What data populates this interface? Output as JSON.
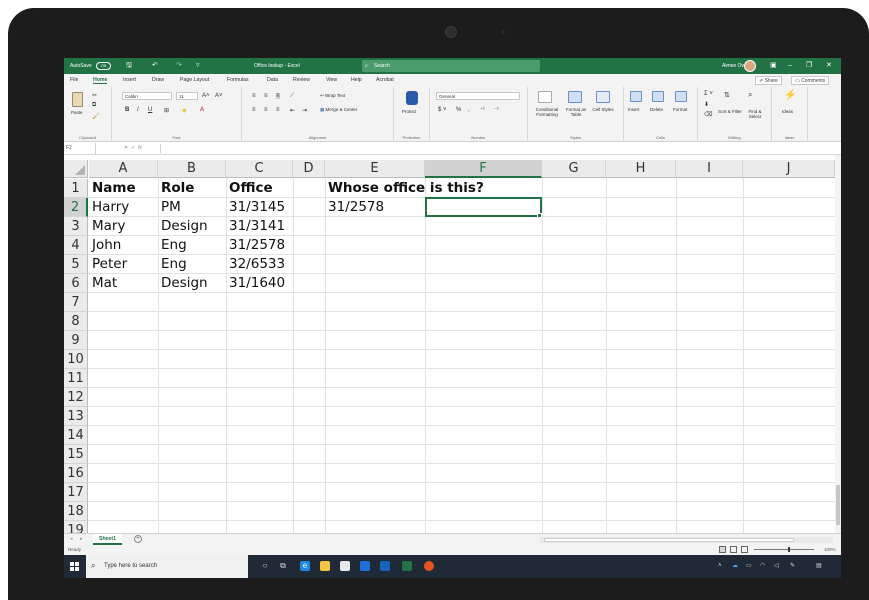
{
  "titlebar": {
    "autosave": "AutoSave",
    "autosave_state": "Off",
    "title": "Office lookup - Excel",
    "search_placeholder": "Search",
    "user": "Aimee Owens",
    "minimize": "–",
    "restore": "❐",
    "close": "✕"
  },
  "ribbon_tabs": [
    "File",
    "Home",
    "Insert",
    "Draw",
    "Page Layout",
    "Formulas",
    "Data",
    "Review",
    "View",
    "Help",
    "Acrobat"
  ],
  "share": "Share",
  "comments": "Comments",
  "ribbon": {
    "clipboard": {
      "label": "Clipboard",
      "paste": "Paste"
    },
    "font": {
      "label": "Font",
      "name": "Calibri",
      "size": "11"
    },
    "alignment": {
      "label": "Alignment",
      "wrap": "Wrap Text",
      "merge": "Merge & Center"
    },
    "protection": {
      "label": "Protection",
      "protect": "Protect"
    },
    "number": {
      "label": "Number",
      "format": "General"
    },
    "styles": {
      "label": "Styles",
      "conditional": "Conditional Formatting",
      "format_table": "Format as Table",
      "cell_styles": "Cell Styles"
    },
    "cells": {
      "label": "Cells",
      "insert": "Insert",
      "delete": "Delete",
      "format": "Format"
    },
    "editing": {
      "label": "Editing",
      "sort": "Sort & Filter",
      "find": "Find & Select"
    },
    "ideas": {
      "label": "Ideas",
      "ideas": "Ideas"
    }
  },
  "formula_bar": {
    "name_box": "F2",
    "fx": "fx",
    "content": ""
  },
  "columns": [
    "A",
    "B",
    "C",
    "D",
    "E",
    "F",
    "G",
    "H",
    "I",
    "J"
  ],
  "rows": [
    "1",
    "2",
    "3",
    "4",
    "5",
    "6",
    "7",
    "8",
    "9",
    "10",
    "11",
    "12",
    "13",
    "14",
    "15",
    "16",
    "17",
    "18",
    "19"
  ],
  "cells": {
    "header": {
      "name": "Name",
      "role": "Role",
      "office": "Office",
      "question": "Whose office is this?"
    },
    "lookup_value": "31/2578",
    "data": [
      {
        "name": "Harry",
        "role": "PM",
        "office": "31/3145"
      },
      {
        "name": "Mary",
        "role": "Design",
        "office": "31/3141"
      },
      {
        "name": "John",
        "role": "Eng",
        "office": "31/2578"
      },
      {
        "name": "Peter",
        "role": "Eng",
        "office": "32/6533"
      },
      {
        "name": "Mat",
        "role": "Design",
        "office": "31/1640"
      }
    ]
  },
  "selected_cell": "F2",
  "sheet_tab": "Sheet1",
  "status": {
    "ready": "Ready",
    "zoom": "100%"
  },
  "taskbar": {
    "search_placeholder": "Type here to search"
  },
  "colors": {
    "excel_green": "#217346",
    "taskbar": "#1f2a36"
  }
}
